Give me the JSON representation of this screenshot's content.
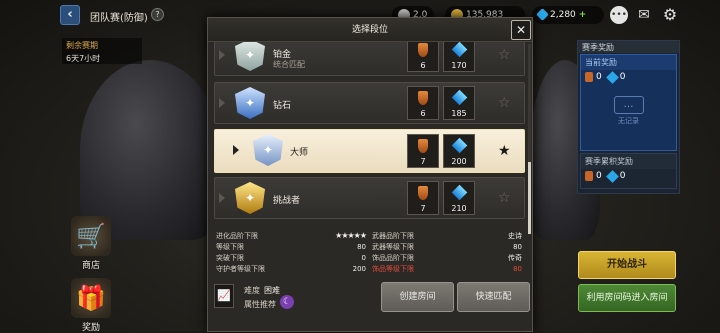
{
  "header": {
    "title": "团队赛(防御)",
    "help_icon": "?",
    "currencies": [
      {
        "name": "currency-1",
        "value": "2,0",
        "color": "#c9c9c9"
      },
      {
        "name": "currency-2",
        "value": "135,983",
        "color": "#e2b53c"
      },
      {
        "name": "gems",
        "value": "2,280",
        "color": "#2aa7e8"
      }
    ]
  },
  "remaining": {
    "label": "剩余赛期",
    "value": "6天7小时"
  },
  "side_menu": [
    {
      "label": "商店",
      "icon": "cart-icon"
    },
    {
      "label": "奖励",
      "icon": "gift-icon"
    }
  ],
  "season_rewards": {
    "title": "赛季奖励",
    "current": {
      "title": "当前奖励",
      "medal": "0",
      "gem": "0",
      "empty_text": "无记录"
    },
    "accumulated": {
      "title": "赛季累积奖励",
      "medal": "0",
      "gem": "0"
    }
  },
  "modal": {
    "title": "选择段位",
    "tiers": [
      {
        "name": "铂金",
        "sub": "统合匹配",
        "medal": "6",
        "gem": "170",
        "color": "#b8c6c2"
      },
      {
        "name": "钻石",
        "sub": "",
        "medal": "6",
        "gem": "185",
        "color": "#5a8ed6"
      },
      {
        "name": "大师",
        "sub": "",
        "medal": "7",
        "gem": "200",
        "color": "#9fb6da"
      },
      {
        "name": "挑战者",
        "sub": "",
        "medal": "7",
        "gem": "210",
        "color": "#d6a730"
      }
    ],
    "selected_tier": "大师",
    "stats": {
      "left": [
        {
          "label": "进化品阶下限",
          "value": "★★★★★"
        },
        {
          "label": "等级下限",
          "value": "80"
        },
        {
          "label": "突破下限",
          "value": "0"
        },
        {
          "label": "守护者等级下限",
          "value": "200"
        }
      ],
      "right": [
        {
          "label": "武器品阶下限",
          "value": "史诗",
          "red": false
        },
        {
          "label": "武器等级下限",
          "value": "80",
          "red": false
        },
        {
          "label": "饰品品阶下限",
          "value": "传奇",
          "red": false
        },
        {
          "label": "饰品等级下限",
          "value": "80",
          "red": true
        }
      ]
    },
    "difficulty": {
      "label": "难度",
      "value": "困难"
    },
    "attribute": {
      "label": "属性推荐"
    },
    "create_room": "创建房间",
    "quick_match": "快速匹配"
  },
  "buttons": {
    "start_battle": "开始战斗",
    "join_by_code": "利用房间码进入房间"
  }
}
